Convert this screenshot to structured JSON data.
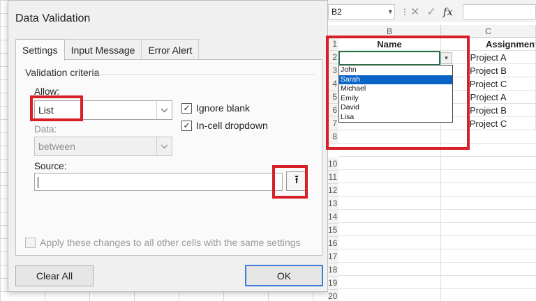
{
  "dialog": {
    "title": "Data Validation",
    "tabs": [
      {
        "label": "Settings",
        "active": true
      },
      {
        "label": "Input Message",
        "active": false
      },
      {
        "label": "Error Alert",
        "active": false
      }
    ],
    "criteria_label": "Validation criteria",
    "allow_label": "Allow:",
    "allow_value": "List",
    "data_label": "Data:",
    "data_value": "between",
    "ignore_blank_label": "Ignore blank",
    "ignore_blank_checked": true,
    "in_cell_dropdown_label": "In-cell dropdown",
    "in_cell_dropdown_checked": true,
    "source_label": "Source:",
    "source_value": "",
    "apply_all_label": "Apply these changes to all other cells with the same settings",
    "apply_all_checked": false,
    "clear_all_label": "Clear All",
    "ok_label": "OK",
    "check_glyph": "✓",
    "collapse_glyph": "⭱"
  },
  "sheet": {
    "namebox": "B2",
    "namebox_dd": "▾",
    "sep": "⋮",
    "cancel_icon": "✕",
    "enter_icon": "✓",
    "fx_label": "fx",
    "columns": [
      "B",
      "C"
    ],
    "rows": [
      "1",
      "2",
      "3",
      "4",
      "5",
      "6",
      "7",
      "8",
      "10",
      "11",
      "12",
      "13",
      "14",
      "15",
      "16",
      "17",
      "18",
      "19",
      "20"
    ],
    "headers": {
      "name": "Name",
      "assignment": "Assignment"
    },
    "assignments": [
      "Project A",
      "Project B",
      "Project C",
      "Project A",
      "Project B",
      "Project C"
    ],
    "dropdown_arrow": "▾",
    "dropdown_options": [
      "John",
      "Sarah",
      "Michael",
      "Emily",
      "David",
      "Lisa"
    ],
    "dropdown_selected": "Sarah"
  },
  "colors": {
    "highlight_red": "#d61f26",
    "selection_blue": "#0a64c8",
    "active_cell_green": "#217346"
  }
}
